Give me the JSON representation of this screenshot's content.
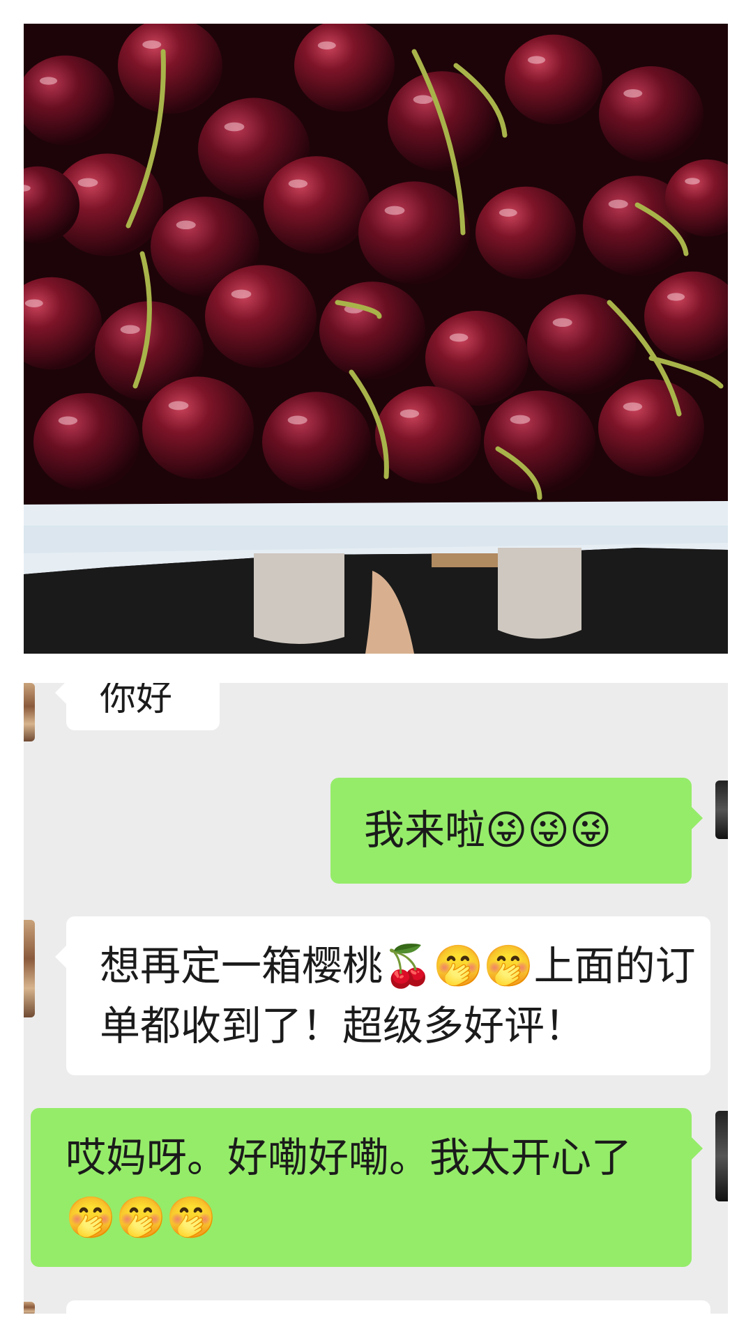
{
  "photo": {
    "subject": "cherries-in-box-photo"
  },
  "chat": {
    "messages": [
      {
        "side": "in",
        "text": "你好"
      },
      {
        "side": "out",
        "text": "我来啦😜😜😜"
      },
      {
        "side": "in",
        "text": "想再定一箱樱桃🍒🤭🤭上面的订单都收到了！超级多好评！"
      },
      {
        "side": "out",
        "text": "哎妈呀。好嘞好嘞。我太开心了🤭🤭🤭"
      }
    ]
  },
  "colors": {
    "bubble_out": "#95ec69",
    "bubble_in": "#ffffff",
    "chat_bg": "#ececec"
  }
}
